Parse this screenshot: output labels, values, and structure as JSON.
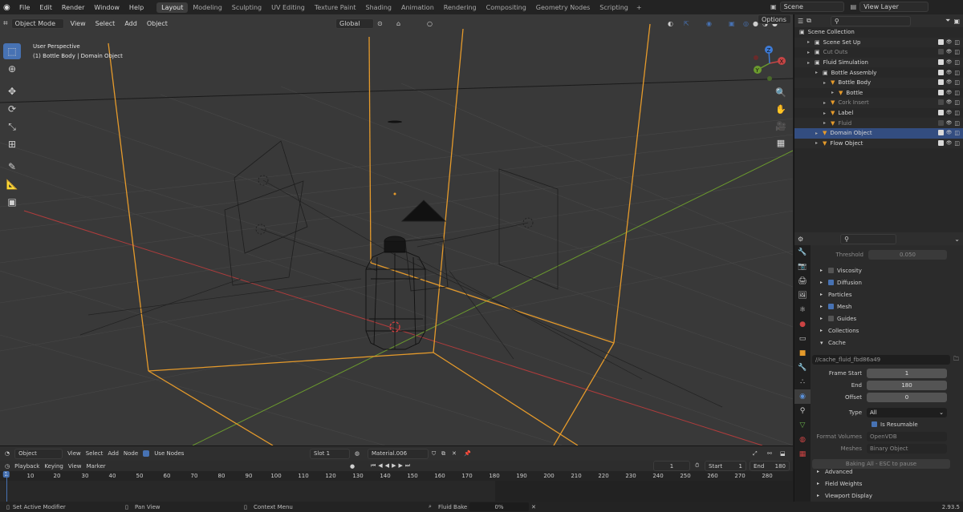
{
  "topbar": {
    "menus": [
      "File",
      "Edit",
      "Render",
      "Window",
      "Help"
    ],
    "workspaces": [
      "Layout",
      "Modeling",
      "Sculpting",
      "UV Editing",
      "Texture Paint",
      "Shading",
      "Animation",
      "Rendering",
      "Compositing",
      "Geometry Nodes",
      "Scripting"
    ],
    "active_workspace": "Layout",
    "scene": "Scene",
    "view_layer": "View Layer"
  },
  "viewport": {
    "mode": "Object Mode",
    "menus": [
      "View",
      "Select",
      "Add",
      "Object"
    ],
    "transform_orientation": "Global",
    "options_label": "Options",
    "perspective_label": "User Perspective",
    "context_label": "(1) Bottle Body | Domain Object",
    "gizmo_axes": {
      "x": "X",
      "y": "Y",
      "z": "Z"
    },
    "colors": {
      "bg": "#3a3a3a",
      "selected_outline": "#e59a2b",
      "x_axis": "#b03c3c",
      "y_axis": "#6b9a2e"
    }
  },
  "outliner": {
    "root": "Scene Collection",
    "rows": [
      {
        "label": "Scene Set Up",
        "indent": 1,
        "icon": "collection-icon",
        "selected": false,
        "dim": false
      },
      {
        "label": "Cut Outs",
        "indent": 1,
        "icon": "collection-icon",
        "selected": false,
        "dim": true
      },
      {
        "label": "Fluid Simulation",
        "indent": 1,
        "icon": "collection-icon",
        "selected": false,
        "dim": false
      },
      {
        "label": "Bottle Assembly",
        "indent": 2,
        "icon": "collection-icon",
        "selected": false,
        "dim": false
      },
      {
        "label": "Bottle Body",
        "indent": 3,
        "icon": "object-icon",
        "selected": false,
        "dim": false
      },
      {
        "label": "Bottle",
        "indent": 4,
        "icon": "object-icon",
        "selected": false,
        "dim": false
      },
      {
        "label": "Cork Insert",
        "indent": 3,
        "icon": "object-icon",
        "selected": false,
        "dim": true
      },
      {
        "label": "Label",
        "indent": 3,
        "icon": "object-icon",
        "selected": false,
        "dim": false
      },
      {
        "label": "Fluid",
        "indent": 3,
        "icon": "object-icon",
        "selected": false,
        "dim": true
      },
      {
        "label": "Domain Object",
        "indent": 2,
        "icon": "object-icon",
        "selected": true,
        "dim": false
      },
      {
        "label": "Flow Object",
        "indent": 2,
        "icon": "object-icon",
        "selected": false,
        "dim": false
      }
    ]
  },
  "properties": {
    "threshold_label": "Threshold",
    "threshold_value": "0.050",
    "panels": [
      {
        "label": "Viscosity",
        "checkbox": true,
        "checked": false
      },
      {
        "label": "Diffusion",
        "checkbox": true,
        "checked": true
      },
      {
        "label": "Particles",
        "checkbox": false,
        "checked": false
      },
      {
        "label": "Mesh",
        "checkbox": true,
        "checked": true
      },
      {
        "label": "Guides",
        "checkbox": true,
        "checked": false
      },
      {
        "label": "Collections",
        "checkbox": false,
        "checked": false
      }
    ],
    "cache": {
      "label": "Cache",
      "path": "//cache_fluid_fbd86a49",
      "frame_start_label": "Frame Start",
      "frame_start": "1",
      "end_label": "End",
      "end": "180",
      "offset_label": "Offset",
      "offset": "0",
      "type_label": "Type",
      "type_value": "All",
      "resumable_label": "Is Resumable",
      "format_volumes_label": "Format Volumes",
      "format_volumes": "OpenVDB",
      "meshes_label": "Meshes",
      "meshes": "Binary Object",
      "bake_label": "Baking All - ESC to pause"
    },
    "bottom_panels": [
      "Advanced",
      "Field Weights",
      "Viewport Display"
    ]
  },
  "shader_bar": {
    "object_label": "Object",
    "menus": [
      "View",
      "Select",
      "Add",
      "Node"
    ],
    "use_nodes_label": "Use Nodes",
    "slot": "Slot 1",
    "material": "Material.006"
  },
  "timeline": {
    "menus": [
      "Playback",
      "Keying",
      "View",
      "Marker"
    ],
    "current_frame": "1",
    "start_label": "Start",
    "start": "1",
    "end_label": "End",
    "end": "180",
    "ruler": [
      "1",
      "10",
      "20",
      "30",
      "40",
      "50",
      "60",
      "70",
      "80",
      "90",
      "100",
      "110",
      "120",
      "130",
      "140",
      "150",
      "160",
      "170",
      "180",
      "190",
      "200",
      "210",
      "220",
      "230",
      "240",
      "250",
      "260",
      "270",
      "280"
    ]
  },
  "statusbar": {
    "left": "Set Active Modifier",
    "mid": "Pan View",
    "ctx": "Context Menu",
    "job": "Fluid Bake",
    "progress": "0%",
    "version": "2.93.5"
  }
}
